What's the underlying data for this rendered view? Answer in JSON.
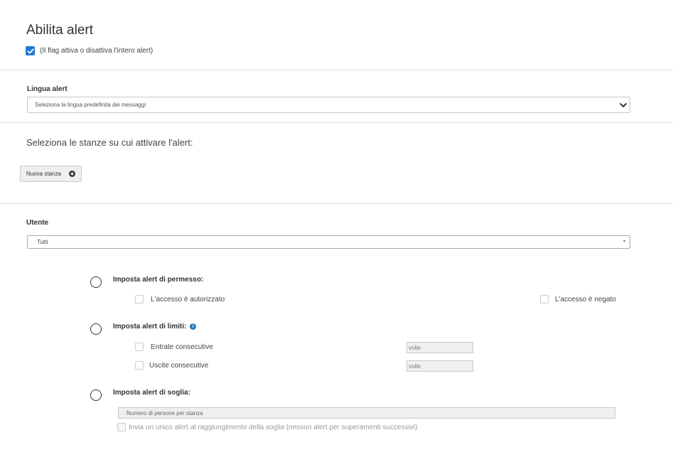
{
  "header": {
    "title": "Abilita alert",
    "enable_hint": "(Il flag attiva o disattiva l'intero alert)",
    "enable_checked": true
  },
  "language": {
    "label": "Lingua alert",
    "selected": "Seleziona la lingua predefinita dei messaggi"
  },
  "rooms": {
    "prompt": "Seleziona le stanze su cui attivare l'alert:",
    "new_room_button": "Nuova stanza"
  },
  "user": {
    "label": "Utente",
    "selected": "Tutti"
  },
  "permission_alert": {
    "title": "Imposta alert di permesso:",
    "authorized_label": "L'accesso è autorizzato",
    "denied_label": "L'accesso è negato"
  },
  "limits_alert": {
    "title": "Imposta alert di limiti:",
    "info_icon": "info-icon",
    "consecutive_entries_label": "Entrate consecutive",
    "consecutive_entries_placeholder": "volte",
    "consecutive_exits_label": "Uscite consecutive",
    "consecutive_exits_placeholder": "volte"
  },
  "threshold_alert": {
    "title": "Imposta alert di soglia:",
    "people_placeholder": "Numero di persone per stanza",
    "single_alert_label": "Invia un unico alert al raggiungimento della soglia (nessun alert per superamenti successivi)"
  },
  "colors": {
    "accent": "#1e7bd6",
    "info": "#2a7bc0",
    "divider": "#e2e2e2"
  }
}
